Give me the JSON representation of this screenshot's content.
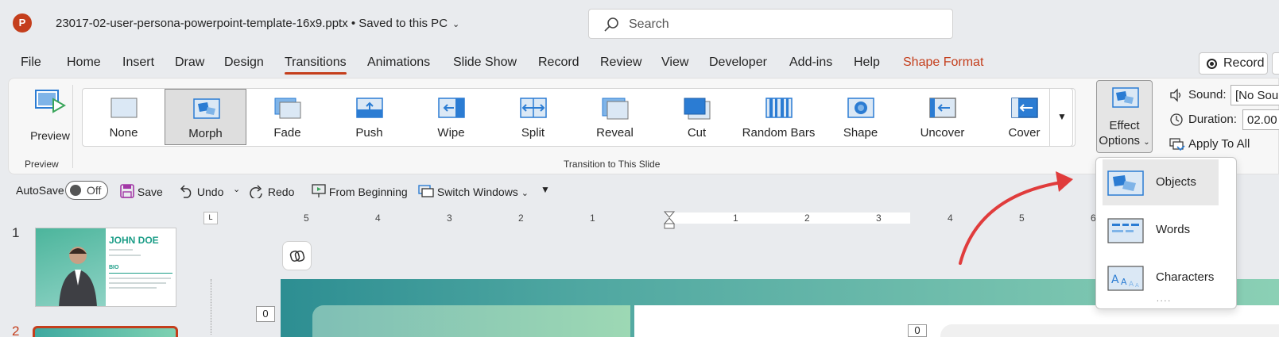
{
  "window": {
    "app_icon": "powerpoint-icon",
    "app_letter": "P",
    "filename": "23017-02-user-persona-powerpoint-template-16x9.pptx • Saved to this PC",
    "search_placeholder": "Search"
  },
  "tabs": [
    {
      "label": "File"
    },
    {
      "label": "Home"
    },
    {
      "label": "Insert"
    },
    {
      "label": "Draw"
    },
    {
      "label": "Design"
    },
    {
      "label": "Transitions",
      "active": true
    },
    {
      "label": "Animations"
    },
    {
      "label": "Slide Show"
    },
    {
      "label": "Record"
    },
    {
      "label": "Review"
    },
    {
      "label": "View"
    },
    {
      "label": "Developer"
    },
    {
      "label": "Add-ins"
    },
    {
      "label": "Help"
    },
    {
      "label": "Shape Format",
      "contextual": true
    }
  ],
  "record_button": "Record",
  "ribbon": {
    "preview_label": "Preview",
    "preview_group": "Preview",
    "transition_group": "Transition to This Slide",
    "transitions": [
      {
        "label": "None",
        "icon": "none-transition-icon"
      },
      {
        "label": "Morph",
        "icon": "morph-transition-icon",
        "selected": true
      },
      {
        "label": "Fade",
        "icon": "fade-transition-icon"
      },
      {
        "label": "Push",
        "icon": "push-transition-icon"
      },
      {
        "label": "Wipe",
        "icon": "wipe-transition-icon"
      },
      {
        "label": "Split",
        "icon": "split-transition-icon"
      },
      {
        "label": "Reveal",
        "icon": "reveal-transition-icon"
      },
      {
        "label": "Cut",
        "icon": "cut-transition-icon"
      },
      {
        "label": "Random Bars",
        "icon": "random-bars-transition-icon"
      },
      {
        "label": "Shape",
        "icon": "shape-transition-icon"
      },
      {
        "label": "Uncover",
        "icon": "uncover-transition-icon"
      },
      {
        "label": "Cover",
        "icon": "cover-transition-icon"
      }
    ],
    "effect_options_line1": "Effect",
    "effect_options_line2": "Options",
    "sound_label": "Sound:",
    "sound_value": "[No Sound]",
    "duration_label": "Duration:",
    "duration_value": "02.00",
    "apply_to_all": "Apply To All"
  },
  "qat": {
    "autosave_label": "AutoSave",
    "autosave_state": "Off",
    "save": "Save",
    "undo": "Undo",
    "redo": "Redo",
    "from_beginning": "From Beginning",
    "switch_windows": "Switch Windows"
  },
  "thumbnails": {
    "slide1_number": "1",
    "slide1_title": "JOHN DOE",
    "slide1_bio": "BIO",
    "slide2_number": "2"
  },
  "ruler": {
    "corner": "L",
    "ticks": [
      "5",
      "4",
      "3",
      "2",
      "1",
      "0",
      "1",
      "2",
      "3",
      "4",
      "5",
      "6"
    ]
  },
  "canvas": {
    "badge_left": "0",
    "badge_right": "0"
  },
  "effect_menu": {
    "items": [
      {
        "label": "Objects",
        "icon": "objects-effect-icon",
        "highlighted": true
      },
      {
        "label": "Words",
        "icon": "words-effect-icon"
      },
      {
        "label": "Characters",
        "icon": "characters-effect-icon"
      }
    ],
    "more": "...."
  },
  "colors": {
    "accent": "#c43e1c",
    "transition_icon_blue": "#2b7cd3",
    "annotation_arrow": "#e03c3c"
  }
}
